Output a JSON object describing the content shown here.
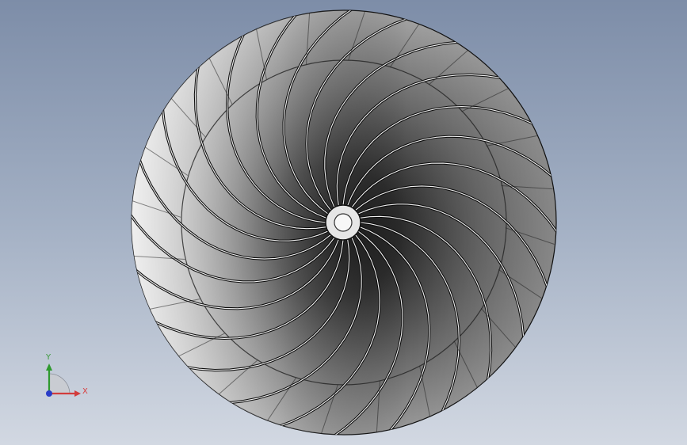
{
  "triad": {
    "x_label": "X",
    "y_label": "Y",
    "x_color": "#d23c3c",
    "y_color": "#2e9a2e",
    "z_color": "#2a3cc8"
  },
  "model": {
    "blade_count": 24,
    "colors": {
      "highlight": "#f2f2f2",
      "shadow": "#1a1a1a",
      "hub": "#e6e6e6",
      "edge": "#111111"
    }
  }
}
